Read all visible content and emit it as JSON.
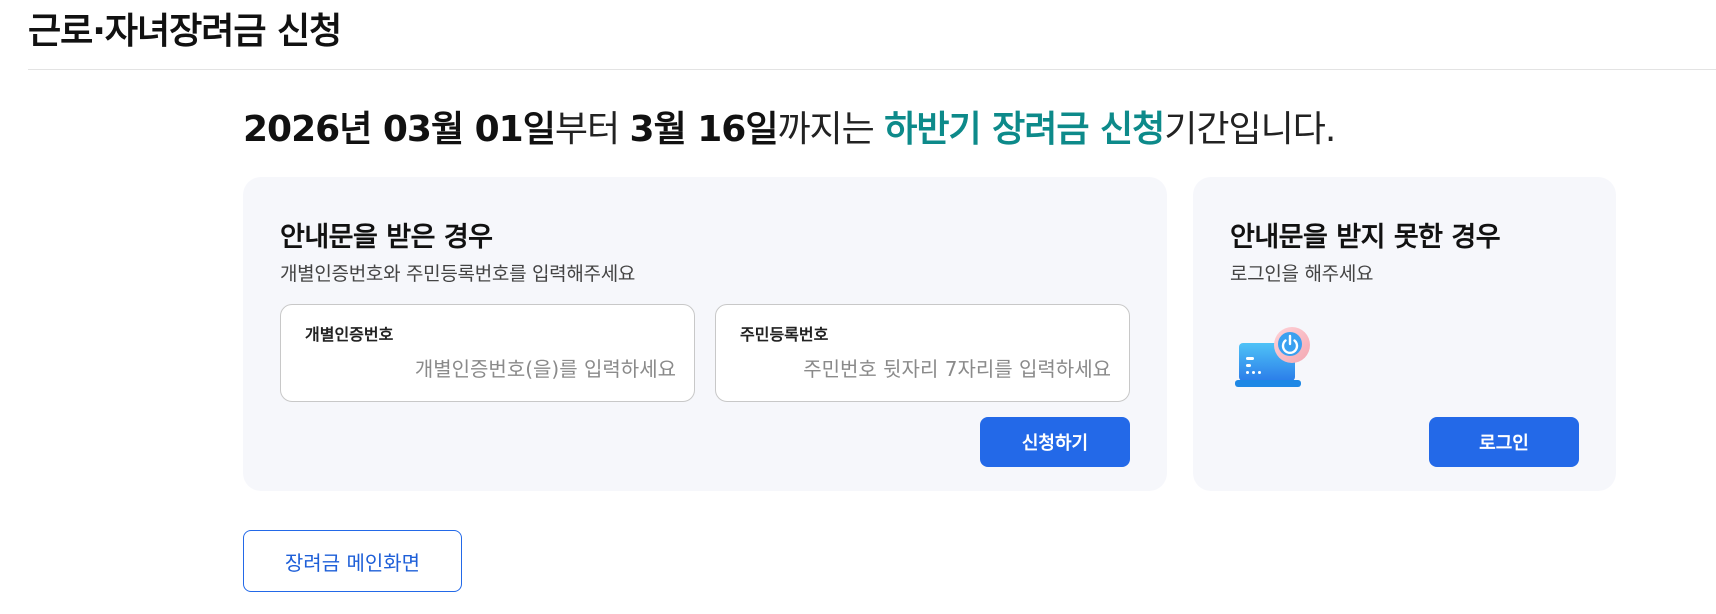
{
  "header": {
    "title": "근로·자녀장려금 신청"
  },
  "period": {
    "start_date": "2026년 03월 01일",
    "from_suffix": "부터 ",
    "end_date": "3월 16일",
    "until_suffix": "까지는 ",
    "application_name": "하반기 장려금 신청",
    "tail": "기간입니다."
  },
  "received_notice": {
    "heading": "안내문을 받은 경우",
    "subtitle": "개별인증번호와 주민등록번호를 입력해주세요",
    "auth_field": {
      "label": "개별인증번호",
      "value": "",
      "placeholder": "개별인증번호(을)를 입력하세요"
    },
    "rrn_field": {
      "label": "주민등록번호",
      "value": "",
      "placeholder": "주민번호 뒷자리 7자리를 입력하세요"
    },
    "apply_button": "신청하기"
  },
  "no_notice": {
    "heading": "안내문을 받지 못한 경우",
    "subtitle": "로그인을 해주세요",
    "illustration": "laptop-power-icon",
    "login_button": "로그인"
  },
  "footer": {
    "main_button": "장려금 메인화면"
  },
  "colors": {
    "accent_teal": "#0d8a8a",
    "primary_blue": "#2369e8",
    "card_bg": "#f6f7fb"
  }
}
